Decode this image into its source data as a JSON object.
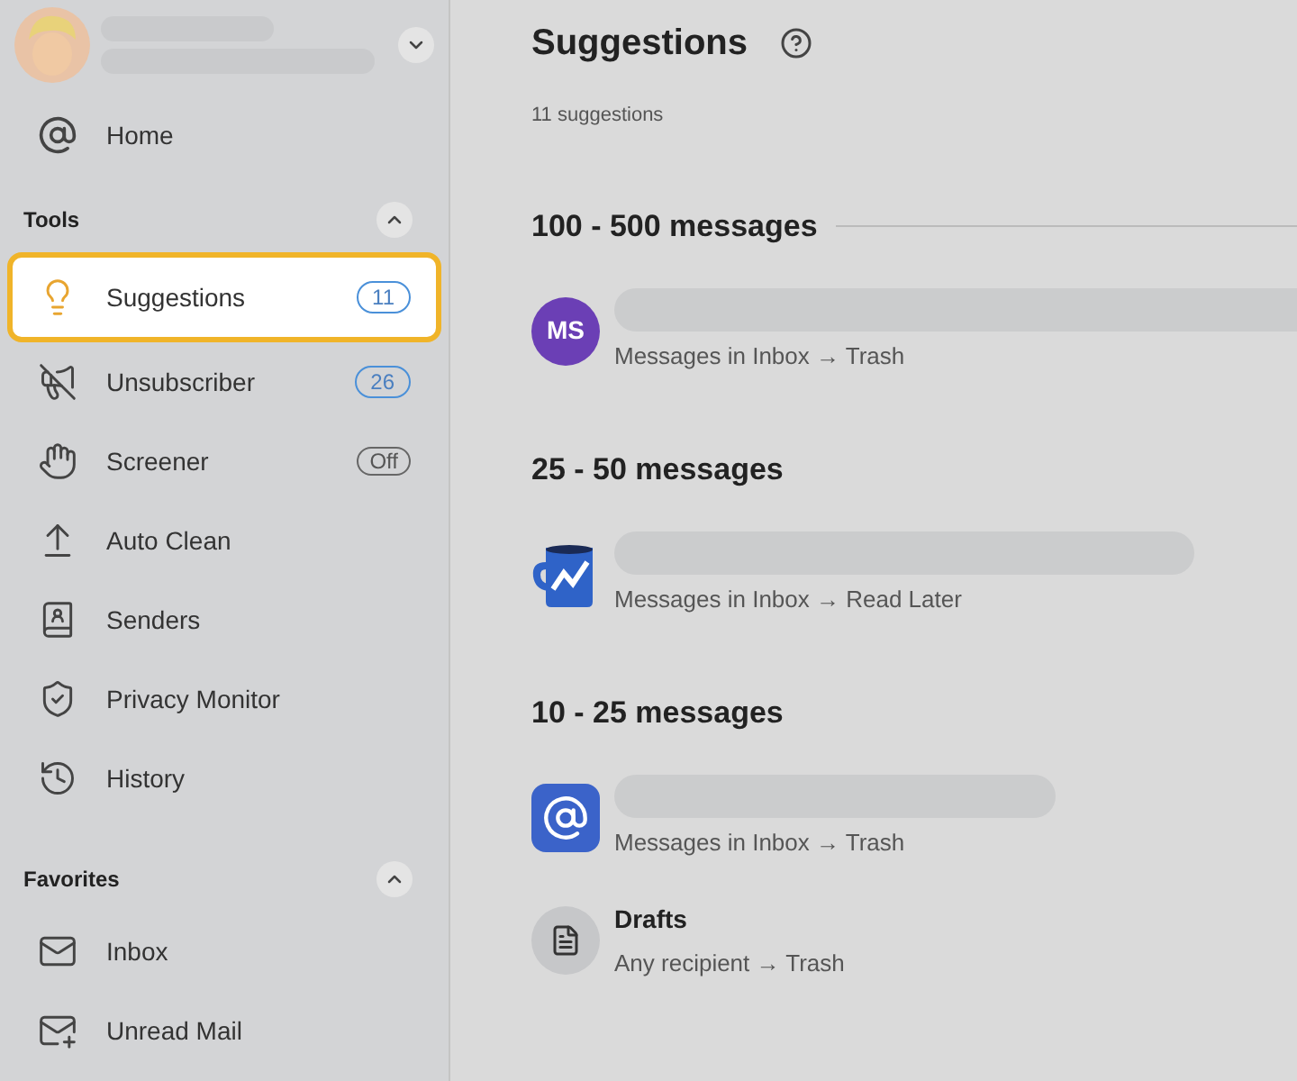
{
  "sidebar": {
    "profile": {
      "expanded": false
    },
    "home": {
      "label": "Home"
    },
    "sections": [
      {
        "title": "Tools",
        "expanded": true,
        "items": [
          {
            "label": "Suggestions",
            "selected": true,
            "badge": {
              "kind": "count",
              "text": "11"
            }
          },
          {
            "label": "Unsubscriber",
            "selected": false,
            "badge": {
              "kind": "count",
              "text": "26"
            }
          },
          {
            "label": "Screener",
            "selected": false,
            "badge": {
              "kind": "toggle",
              "text": "Off"
            }
          },
          {
            "label": "Auto Clean",
            "selected": false
          },
          {
            "label": "Senders",
            "selected": false
          },
          {
            "label": "Privacy Monitor",
            "selected": false
          },
          {
            "label": "History",
            "selected": false
          }
        ]
      },
      {
        "title": "Favorites",
        "expanded": true,
        "items": [
          {
            "label": "Inbox",
            "selected": false
          },
          {
            "label": "Unread Mail",
            "selected": false
          }
        ]
      }
    ]
  },
  "main": {
    "title": "Suggestions",
    "count": "11 suggestions",
    "groups": [
      {
        "heading": "100 - 500 messages",
        "items": [
          {
            "icon": {
              "kind": "initials",
              "text": "MS",
              "color": "#6b3fb5"
            },
            "rule": "Messages in Inbox → Trash"
          }
        ]
      },
      {
        "heading": "25 - 50 messages",
        "items": [
          {
            "icon": {
              "kind": "mug"
            },
            "rule": "Messages in Inbox → Read Later"
          }
        ]
      },
      {
        "heading": "10 - 25 messages",
        "items": [
          {
            "icon": {
              "kind": "at"
            },
            "rule": "Messages in Inbox → Trash"
          },
          {
            "icon": {
              "kind": "document"
            },
            "title": "Drafts",
            "rule": "Any recipient → Trash"
          }
        ]
      }
    ]
  }
}
